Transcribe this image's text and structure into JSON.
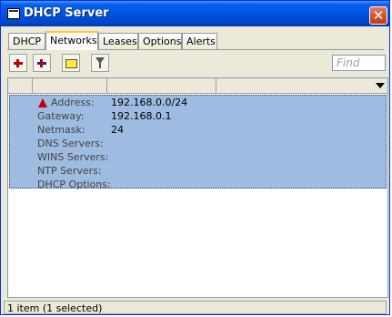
{
  "window": {
    "title": "DHCP Server",
    "close_glyph": "✕"
  },
  "tabs": [
    {
      "label": "DHCP"
    },
    {
      "label": "Networks",
      "active": true
    },
    {
      "label": "Leases"
    },
    {
      "label": "Options"
    },
    {
      "label": "Alerts"
    }
  ],
  "toolbar": {
    "add_icon": "plus-icon",
    "remove_icon": "minus-icon",
    "comment_icon": "note-icon",
    "filter_icon": "filter-icon",
    "find_placeholder": "Find"
  },
  "list": {
    "record": {
      "fields": [
        {
          "label": "Address:",
          "value": "192.168.0.0/24"
        },
        {
          "label": "Gateway:",
          "value": "192.168.0.1"
        },
        {
          "label": "Netmask:",
          "value": "24"
        },
        {
          "label": "DNS Servers:",
          "value": ""
        },
        {
          "label": "WINS Servers:",
          "value": ""
        },
        {
          "label": "NTP Servers:",
          "value": ""
        },
        {
          "label": "DHCP Options:",
          "value": ""
        }
      ]
    }
  },
  "status": {
    "text": "1 item (1 selected)"
  },
  "colors": {
    "selection": "#9ebbe1",
    "titlebar": "#0054e3",
    "active_tab_accent": "#ffc83c"
  }
}
